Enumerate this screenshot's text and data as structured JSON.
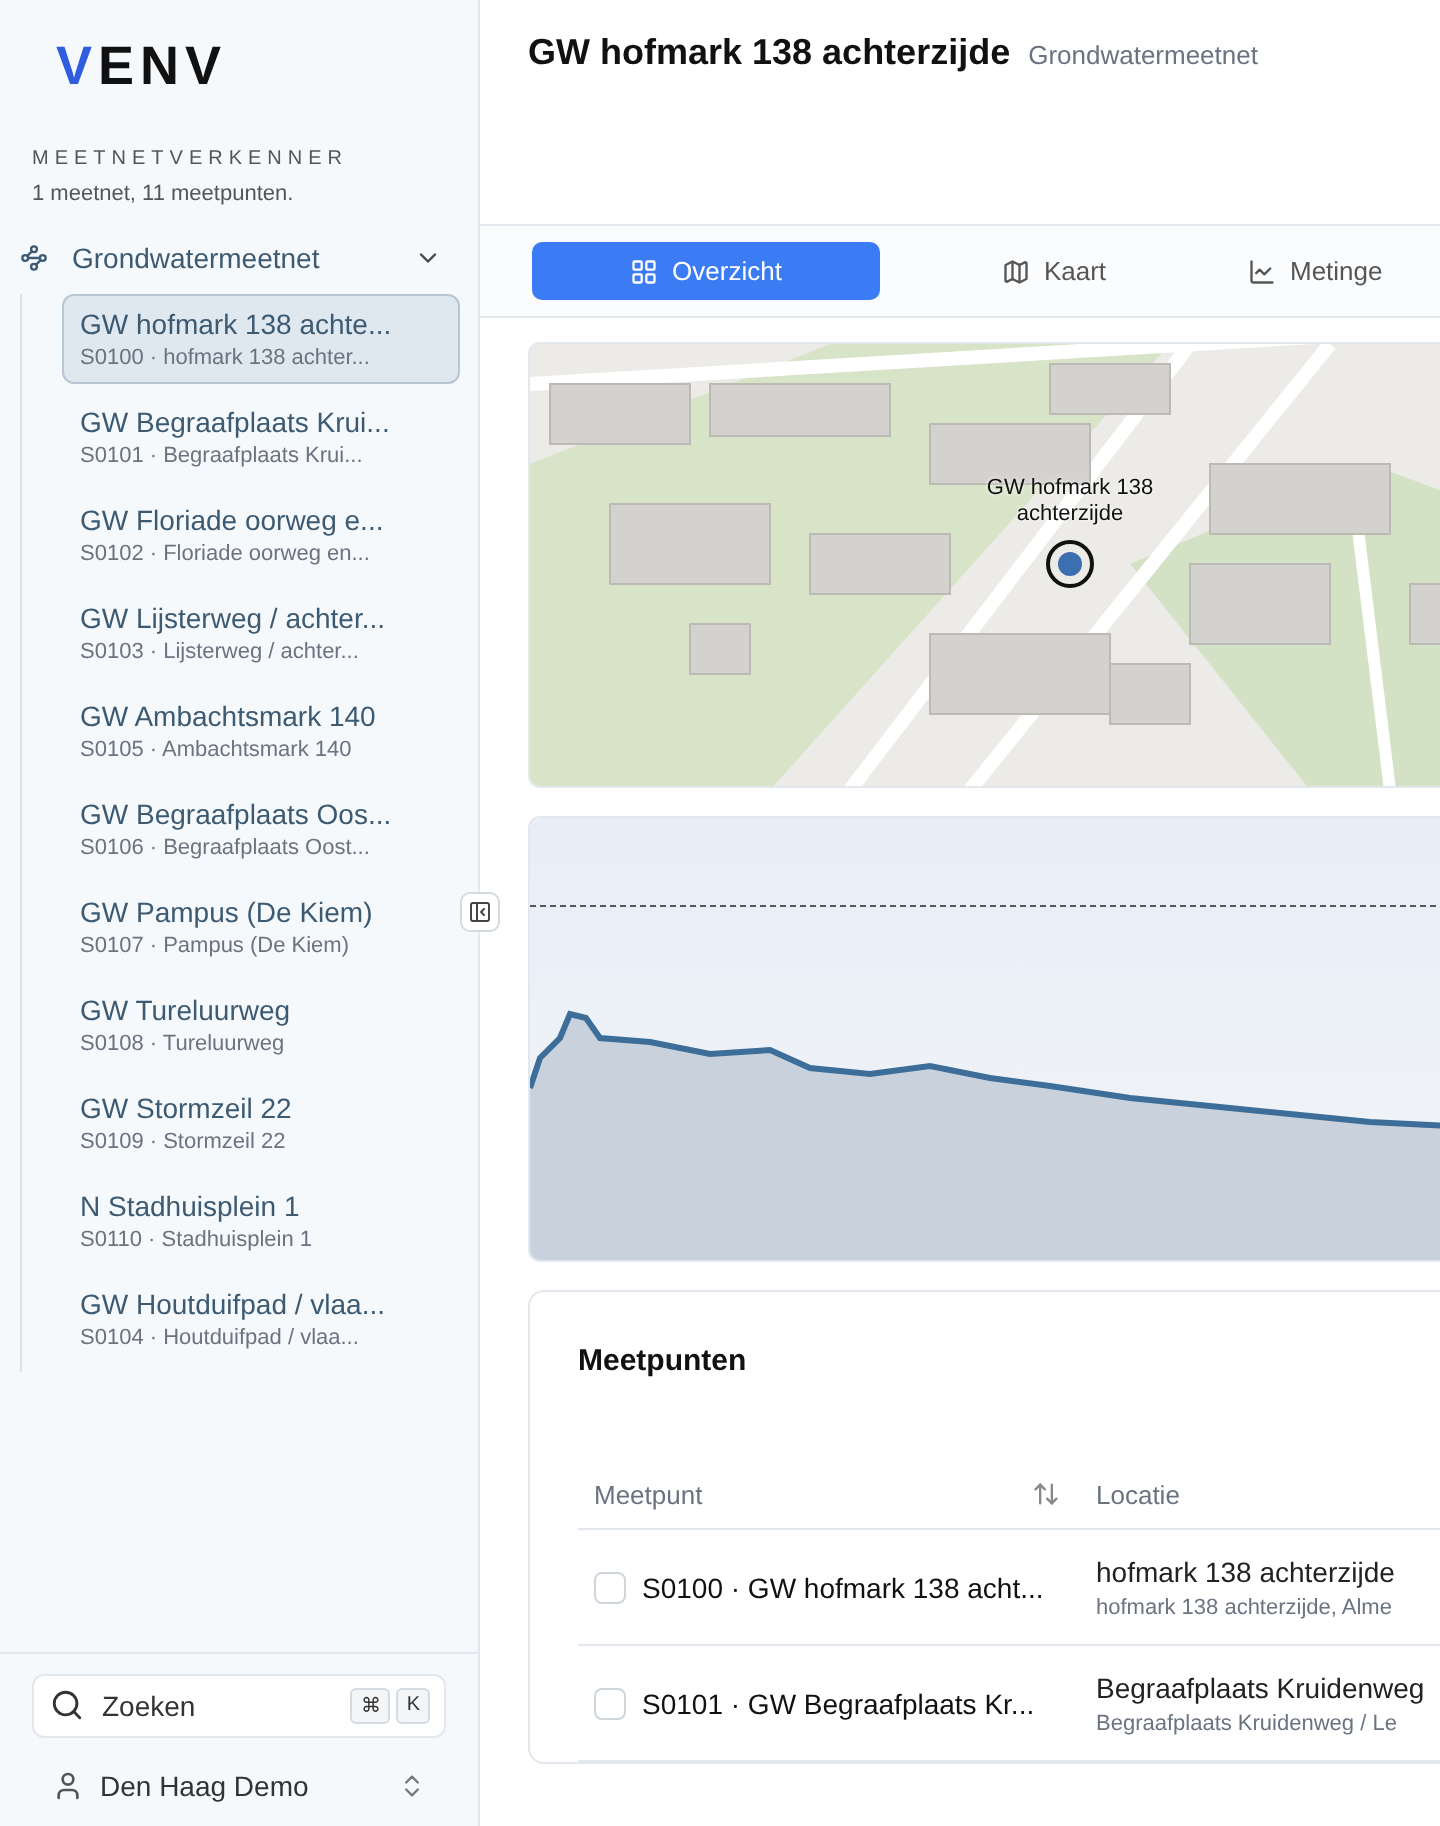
{
  "sidebar": {
    "logo": "VENV",
    "section_title": "MEETNETVERKENNER",
    "summary": "1 meetnet, 11 meetpunten.",
    "group": {
      "label": "Grondwatermeetnet",
      "expanded": true,
      "children": [
        {
          "title": "GW hofmark 138 achte...",
          "subtitle": "S0100 · hofmark 138 achter...",
          "selected": true
        },
        {
          "title": "GW Begraafplaats Krui...",
          "subtitle": "S0101 · Begraafplaats Krui...",
          "selected": false
        },
        {
          "title": "GW Floriade oorweg e...",
          "subtitle": "S0102 · Floriade oorweg en...",
          "selected": false
        },
        {
          "title": "GW Lijsterweg / achter...",
          "subtitle": "S0103 · Lijsterweg / achter...",
          "selected": false
        },
        {
          "title": "GW Ambachtsmark 140",
          "subtitle": "S0105 · Ambachtsmark 140",
          "selected": false
        },
        {
          "title": "GW Begraafplaats Oos...",
          "subtitle": "S0106 · Begraafplaats Oost...",
          "selected": false
        },
        {
          "title": "GW Pampus (De Kiem)",
          "subtitle": "S0107 · Pampus (De Kiem)",
          "selected": false
        },
        {
          "title": "GW Tureluurweg",
          "subtitle": "S0108 · Tureluurweg",
          "selected": false
        },
        {
          "title": "GW Stormzeil 22",
          "subtitle": "S0109 · Stormzeil 22",
          "selected": false
        },
        {
          "title": "N Stadhuisplein 1",
          "subtitle": "S0110 · Stadhuisplein 1",
          "selected": false
        },
        {
          "title": "GW Houtduifpad / vlaa...",
          "subtitle": "S0104 · Houtduifpad / vlaa...",
          "selected": false
        }
      ]
    },
    "search": {
      "placeholder": "Zoeken",
      "keys": [
        "⌘",
        "K"
      ]
    },
    "account": {
      "name": "Den Haag Demo"
    }
  },
  "header": {
    "title": "GW hofmark 138 achterzijde",
    "subtitle": "Grondwatermeetnet"
  },
  "tabs": [
    {
      "label": "Overzicht",
      "selected": true
    },
    {
      "label": "Kaart",
      "selected": false
    },
    {
      "label": "Metinge",
      "selected": false
    }
  ],
  "map": {
    "marker_label": "GW hofmark 138 achterzijde"
  },
  "table": {
    "title": "Meetpunten",
    "columns": [
      "Meetpunt",
      "Locatie"
    ],
    "rows": [
      {
        "checked": false,
        "meetpunt": "S0100 · GW hofmark 138 acht...",
        "location": "hofmark 138 achterzijde",
        "address": "hofmark 138 achterzijde, Alme"
      },
      {
        "checked": false,
        "meetpunt": "S0101 · GW Begraafplaats Kr...",
        "location": "Begraafplaats Kruidenweg",
        "address": "Begraafplaats Kruidenweg / Le"
      }
    ]
  }
}
